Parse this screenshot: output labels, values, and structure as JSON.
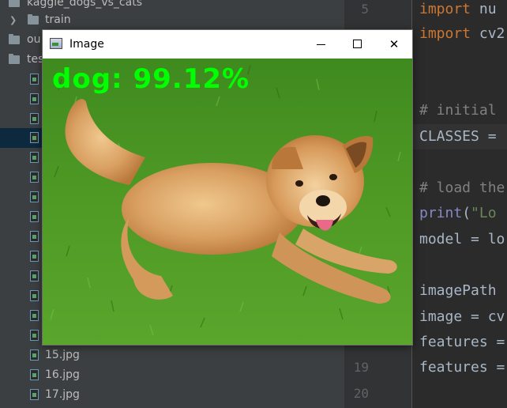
{
  "project_tree": {
    "items": [
      {
        "label": "kaggle_dogs_vs_cats",
        "type": "folder"
      },
      {
        "label": "train",
        "type": "folder"
      },
      {
        "label": "ou",
        "type": "folder"
      },
      {
        "label": "tes",
        "type": "folder"
      },
      {
        "label": "15.jpg",
        "type": "file"
      },
      {
        "label": "16.jpg",
        "type": "file"
      },
      {
        "label": "17.jpg",
        "type": "file"
      }
    ]
  },
  "editor": {
    "line_numbers": [
      "5",
      "19",
      "20"
    ],
    "lines": [
      {
        "kw": "import",
        "text": " nu"
      },
      {
        "kw": "import",
        "text": " cv2"
      },
      {
        "comment": "# initial"
      },
      {
        "text": "CLASSES ="
      },
      {
        "comment": "# load the"
      },
      {
        "fn": "print",
        "text": "(",
        "str": "\"Lo"
      },
      {
        "text": "model = lo"
      },
      {
        "text": "imagePath"
      },
      {
        "text": "image = cv"
      },
      {
        "text": "features ="
      },
      {
        "text": "features ="
      }
    ]
  },
  "image_window": {
    "title": "Image",
    "minimize_symbol": "—",
    "maximize_symbol": "☐",
    "close_symbol": "✕",
    "prediction_text": "dog: 99.12%",
    "prediction_color": "#00ff00"
  },
  "colors": {
    "ide_panel": "#3c3f41",
    "editor_bg": "#2b2b2b",
    "keyword": "#cc7832",
    "comment": "#808080"
  }
}
